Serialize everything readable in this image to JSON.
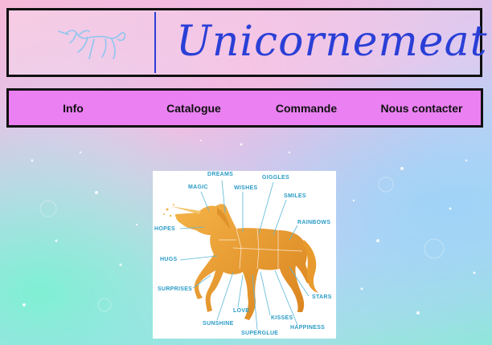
{
  "header": {
    "site_title": "Unicornemeat",
    "logo_icon": "unicorn-icon"
  },
  "nav": {
    "items": [
      {
        "label": "Info"
      },
      {
        "label": "Catalogue"
      },
      {
        "label": "Commande"
      },
      {
        "label": "Nous contacter"
      }
    ]
  },
  "diagram": {
    "labels": {
      "dreams": "DREAMS",
      "giggles": "GIGGLES",
      "magic": "MAGIC",
      "wishes": "WISHES",
      "smiles": "SMILES",
      "rainbows": "RAINBOWS",
      "hopes": "HOPES",
      "hugs": "HUGS",
      "surprises": "SURPRISES",
      "stars": "STARS",
      "love": "LOVE",
      "sunshine": "SUNSHINE",
      "kisses": "KISSES",
      "happiness": "HAPPINESS",
      "superglue": "SUPERGLUE"
    },
    "colors": {
      "unicorn": "#e89a2c",
      "label": "#2a9cc6"
    }
  }
}
